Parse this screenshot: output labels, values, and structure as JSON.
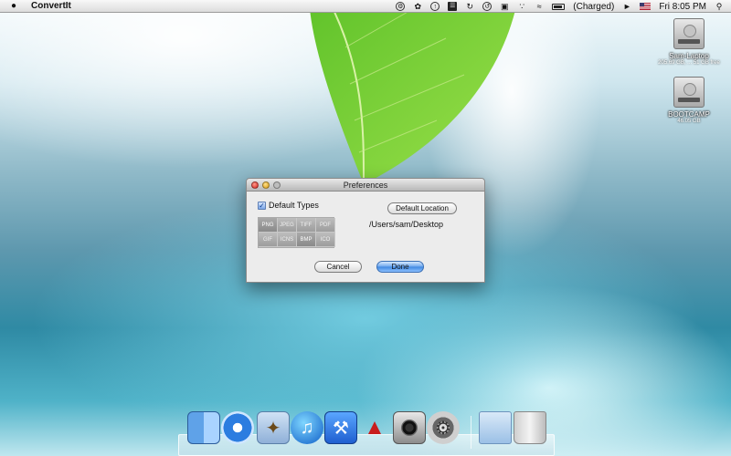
{
  "menubar": {
    "app_name": "ConvertIt",
    "battery_status": "(Charged)",
    "clock": "Fri 8:05 PM",
    "status_icons": [
      "gear-status-icon",
      "paw-icon",
      "sync-icon",
      "document-icon",
      "refresh-icon",
      "time-machine-icon",
      "display-icon",
      "bluetooth-icon",
      "wifi-icon",
      "battery-icon",
      "volume-icon",
      "us-flag-icon",
      "spotlight-icon"
    ]
  },
  "desktop": {
    "drives": [
      {
        "name": "Sam-Laptop",
        "size": "205.69 GB, ... 51 GB free"
      },
      {
        "name": "BOOTCAMP",
        "size": "46.05 GB"
      }
    ]
  },
  "dialog": {
    "title": "Preferences",
    "default_types_label": "Default Types",
    "default_types_checked": true,
    "types": [
      {
        "label": "PNG",
        "selected": true
      },
      {
        "label": "JPEG",
        "selected": false
      },
      {
        "label": "TIFF",
        "selected": false
      },
      {
        "label": "PDF",
        "selected": false
      },
      {
        "label": "GIF",
        "selected": false
      },
      {
        "label": "ICNS",
        "selected": false
      },
      {
        "label": "BMP",
        "selected": true
      },
      {
        "label": "ICO",
        "selected": false
      }
    ],
    "default_location_button": "Default Location",
    "location_path": "/Users/sam/Desktop",
    "cancel_label": "Cancel",
    "done_label": "Done"
  },
  "dock": {
    "items": [
      "finder",
      "safari",
      "mail",
      "itunes",
      "xcode",
      "stamp",
      "photo-booth",
      "system-preferences",
      "downloads-folder",
      "trash"
    ]
  }
}
